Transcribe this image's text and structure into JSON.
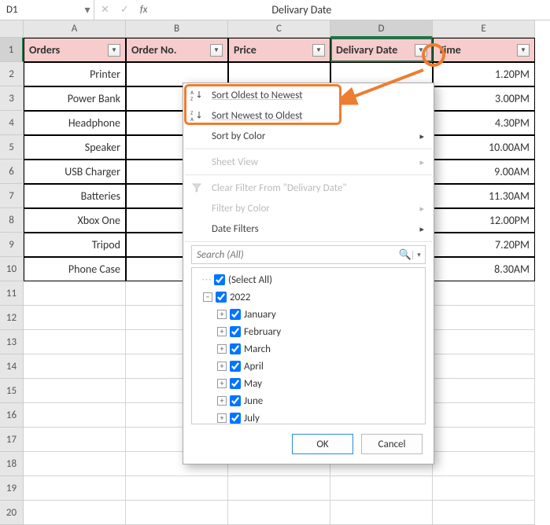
{
  "name_box": "D1",
  "formula_value": "Delivary Date",
  "columns": [
    "A",
    "B",
    "C",
    "D",
    "E"
  ],
  "active_col_index": 3,
  "headers": {
    "A": "Orders",
    "B": "Order No.",
    "C": "Price",
    "D": "Delivary Date",
    "E": "Time"
  },
  "rows": [
    {
      "A": "Printer",
      "E": "1.20PM"
    },
    {
      "A": "Power Bank",
      "E": "3.00PM"
    },
    {
      "A": "Headphone",
      "E": "4.30PM"
    },
    {
      "A": "Speaker",
      "E": "10.00AM"
    },
    {
      "A": "USB Charger",
      "E": "9.00AM"
    },
    {
      "A": "Batteries",
      "E": "11.30AM"
    },
    {
      "A": "Xbox One",
      "E": "12.00PM"
    },
    {
      "A": "Tripod",
      "E": "7.20PM"
    },
    {
      "A": "Phone Case",
      "E": "8.30AM"
    }
  ],
  "dropdown": {
    "sort_oldest": "Sort Oldest to Newest",
    "sort_newest": "Sort Newest to Oldest",
    "sort_color": "Sort by Color",
    "sheet_view": "Sheet View",
    "clear_filter": "Clear Filter From \"Delivary Date\"",
    "filter_color": "Filter by Color",
    "date_filters": "Date Filters",
    "search_placeholder": "Search (All)",
    "tree": {
      "select_all": "(Select All)",
      "year": "2022",
      "months": [
        "January",
        "February",
        "March",
        "April",
        "May",
        "June",
        "July"
      ]
    },
    "ok": "OK",
    "cancel": "Cancel"
  },
  "icons": {
    "sort_asc": "A↓Z",
    "sort_desc": "Z↓A",
    "funnel": "▼",
    "search": "🔍"
  }
}
